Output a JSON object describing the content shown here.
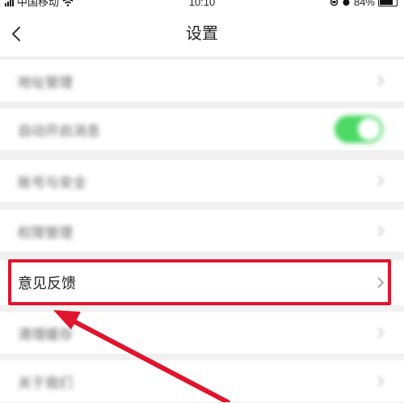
{
  "status_bar": {
    "carrier": "中国移动",
    "time": "10:10",
    "battery": "84%"
  },
  "header": {
    "title": "设置"
  },
  "settings_list": {
    "items": [
      {
        "label": "地址管理",
        "blurred": true,
        "control": "chevron"
      },
      {
        "label": "自动开启消息",
        "blurred": true,
        "control": "toggle"
      },
      {
        "label": "账号与安全",
        "blurred": true,
        "control": "chevron"
      },
      {
        "label": "权限管理",
        "blurred": true,
        "control": "chevron"
      },
      {
        "label": "意见反馈",
        "blurred": false,
        "control": "chevron"
      },
      {
        "label": "清理缓存",
        "blurred": true,
        "control": "chevron"
      },
      {
        "label": "关于我们",
        "blurred": true,
        "control": "chevron"
      }
    ]
  },
  "annotation": {
    "highlight_color": "#e0142c"
  },
  "colors": {
    "toggle_on": "#4cd964"
  }
}
